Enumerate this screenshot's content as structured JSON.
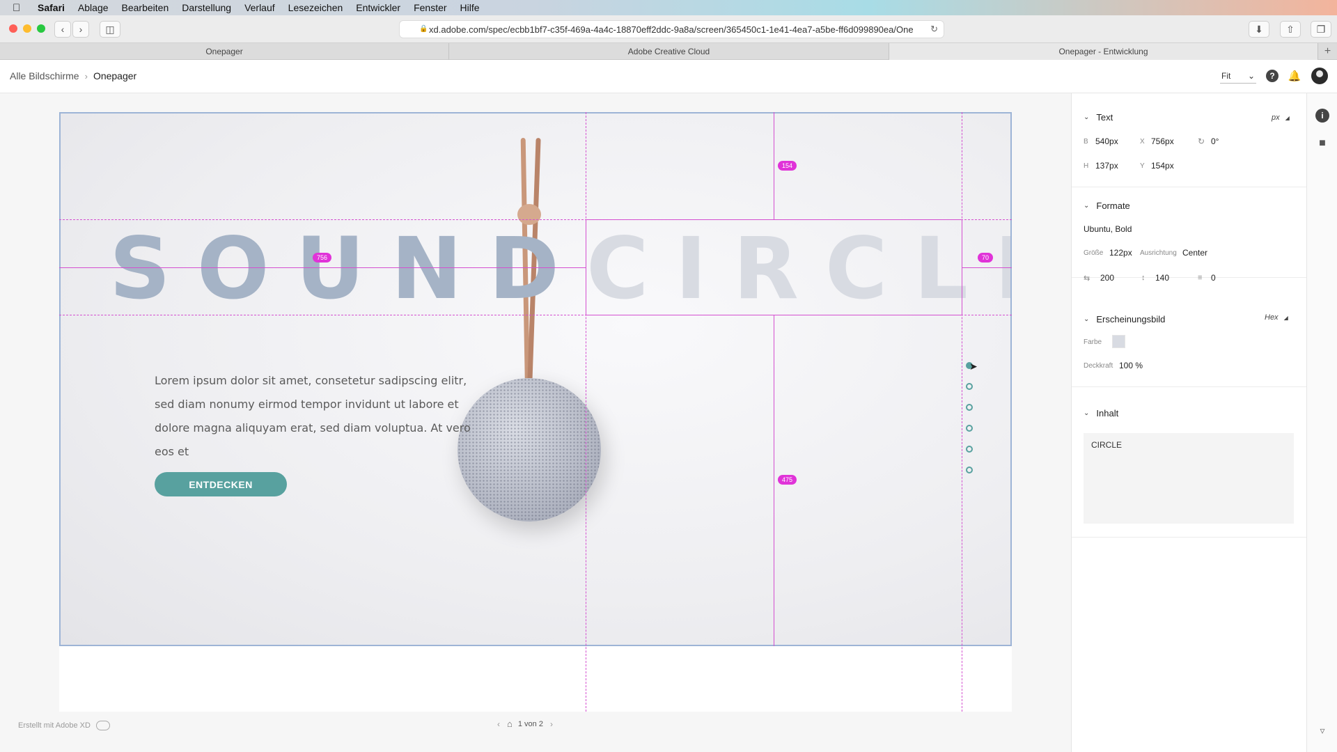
{
  "menubar": {
    "app": "Safari",
    "items": [
      "Ablage",
      "Bearbeiten",
      "Darstellung",
      "Verlauf",
      "Lesezeichen",
      "Entwickler",
      "Fenster",
      "Hilfe"
    ]
  },
  "browser": {
    "url": "xd.adobe.com/spec/ecbb1bf7-c35f-469a-4a4c-18870eff2ddc-9a8a/screen/365450c1-1e41-4ea7-a5be-ff6d099890ea/One",
    "tabs": [
      "Onepager",
      "Adobe Creative Cloud",
      "Onepager - Entwicklung"
    ]
  },
  "header": {
    "breadcrumb_root": "Alle Bildschirme",
    "breadcrumb_current": "Onepager",
    "zoom": "Fit"
  },
  "artboard": {
    "word1": "SOUND",
    "word2": "CIRCLE",
    "lorem": "Lorem ipsum dolor sit amet, consetetur sadipscing elitr, sed diam nonumy eirmod tempor invidunt ut labore et dolore magna aliquyam erat, sed diam voluptua. At vero eos et",
    "cta": "ENTDECKEN",
    "measures": {
      "top": "154",
      "left": "756",
      "right": "70",
      "bottom": "475"
    }
  },
  "footer": {
    "made_with": "Erstellt mit Adobe XD",
    "pager": "1 von 2"
  },
  "inspector": {
    "text": {
      "title": "Text",
      "unit": "px",
      "b_label": "B",
      "b_value": "540px",
      "x_label": "X",
      "x_value": "756px",
      "rotation": "0°",
      "h_label": "H",
      "h_value": "137px",
      "y_label": "Y",
      "y_value": "154px"
    },
    "formats": {
      "title": "Formate",
      "font": "Ubuntu, Bold",
      "size_label": "Größe",
      "size_value": "122px",
      "align_label": "Ausrichtung",
      "align_value": "Center",
      "tracking": "200",
      "line_height": "140",
      "paragraph": "0"
    },
    "appearance": {
      "title": "Erscheinungsbild",
      "unit": "Hex",
      "color_label": "Farbe",
      "color_value": "#d8dbe2",
      "opacity_label": "Deckkraft",
      "opacity_value": "100 %"
    },
    "content": {
      "title": "Inhalt",
      "value": "CIRCLE"
    }
  },
  "colors": {
    "accent": "#58a19f",
    "spec_guide": "#d44fd0",
    "measure_badge": "#e033d8"
  }
}
